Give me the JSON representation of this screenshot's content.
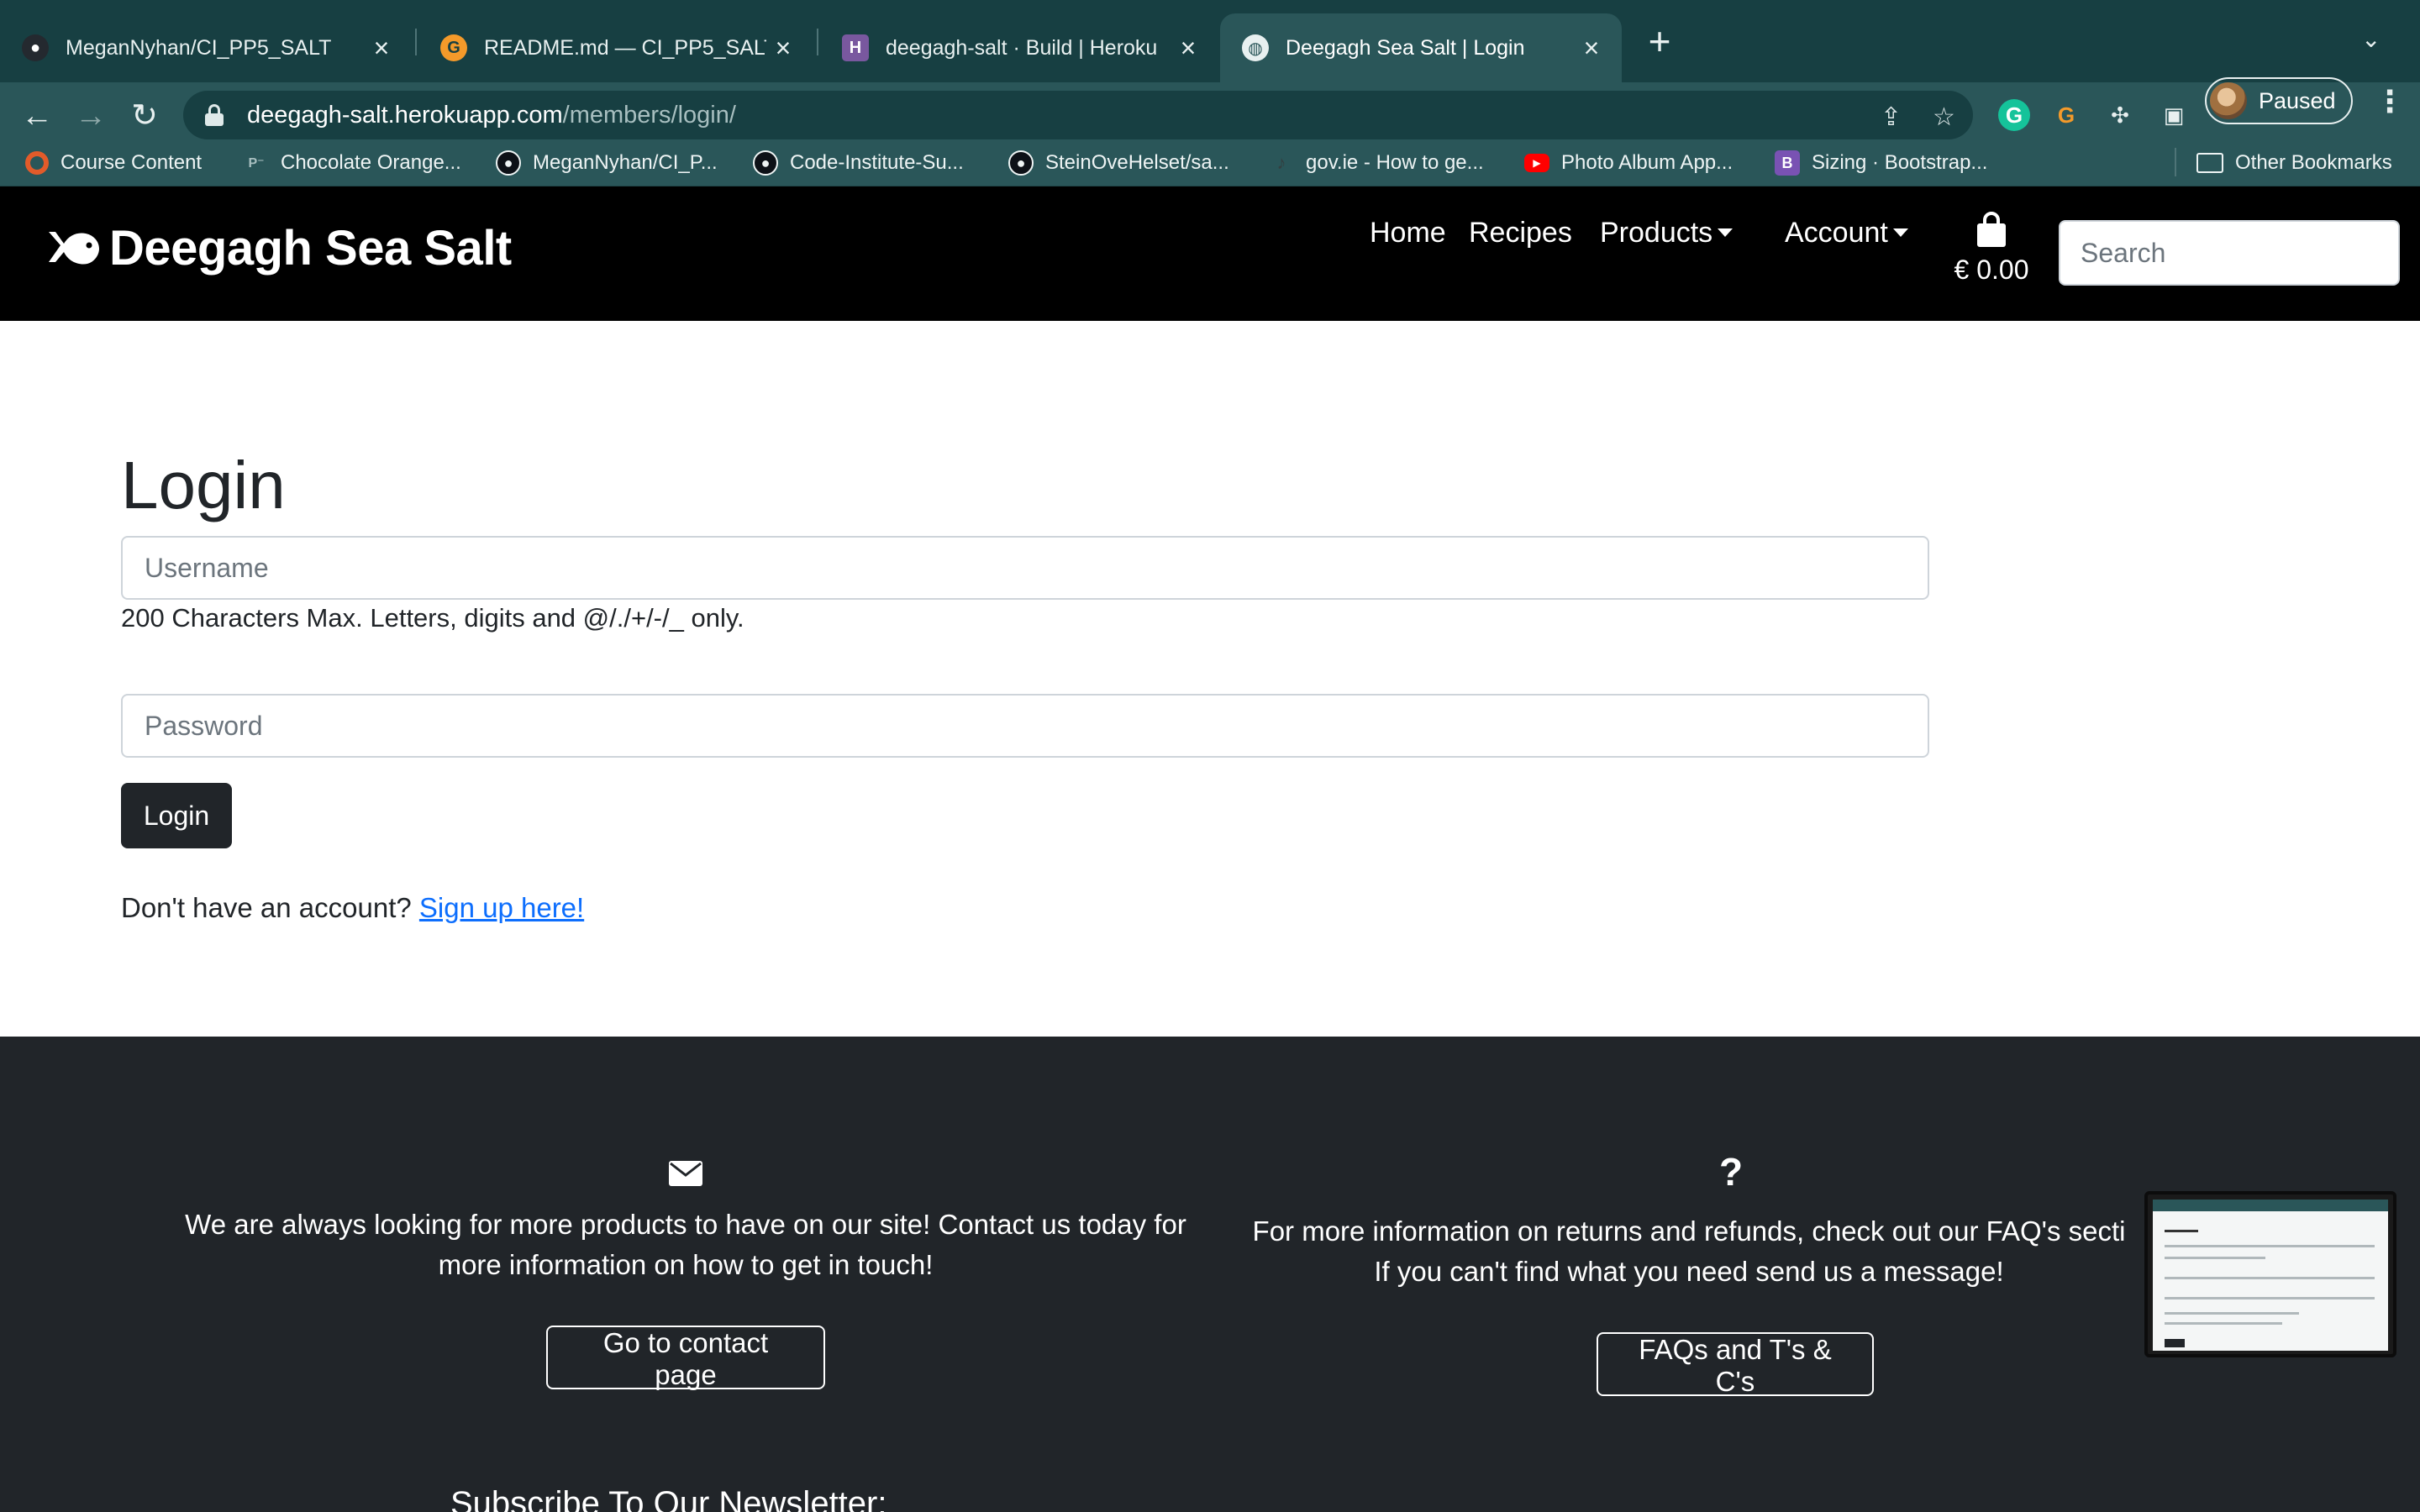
{
  "browser": {
    "tabs": [
      {
        "title": "MeganNyhan/CI_PP5_SALT",
        "favicon": "github-icon",
        "active": false
      },
      {
        "title": "README.md — CI_PP5_SALT —",
        "favicon": "gitpod-icon",
        "active": false
      },
      {
        "title": "deegagh-salt · Build | Heroku",
        "favicon": "heroku-icon",
        "active": false
      },
      {
        "title": "Deegagh Sea Salt | Login",
        "favicon": "globe-icon",
        "active": true
      }
    ],
    "url_host": "deegagh-salt.herokuapp.com",
    "url_path": "/members/login/",
    "profile_label": "Paused",
    "bookmarks": [
      {
        "label": "Course Content",
        "icon": "circle-icon"
      },
      {
        "label": "Chocolate Orange...",
        "icon": "p-icon"
      },
      {
        "label": "MeganNyhan/CI_P...",
        "icon": "github-icon"
      },
      {
        "label": "Code-Institute-Su...",
        "icon": "github-icon"
      },
      {
        "label": "SteinOveHelset/sa...",
        "icon": "github-icon"
      },
      {
        "label": "gov.ie - How to ge...",
        "icon": "harp-icon"
      },
      {
        "label": "Photo Album App...",
        "icon": "youtube-icon"
      },
      {
        "label": "Sizing · Bootstrap...",
        "icon": "bootstrap-icon"
      }
    ],
    "other_bookmarks": "Other Bookmarks"
  },
  "site": {
    "brand": "Deegagh Sea Salt",
    "nav": {
      "home": "Home",
      "recipes": "Recipes",
      "products": "Products",
      "account": "Account"
    },
    "bag_total": "€ 0.00",
    "search_placeholder": "Search"
  },
  "login": {
    "title": "Login",
    "username_placeholder": "Username",
    "username_help": "200 Characters Max. Letters, digits and @/./+/-/_ only.",
    "password_placeholder": "Password",
    "button": "Login",
    "signup_prompt": "Don't have an account?",
    "signup_link": "Sign up here!"
  },
  "footer": {
    "contact_line1": "We are always looking for more products to have on our site! Contact us today for",
    "contact_line2": "more information on how to get in touch!",
    "contact_button": "Go to contact page",
    "faq_icon_char": "?",
    "faq_line1": "For more information on returns and refunds, check out our FAQ's secti",
    "faq_line2": "If you can't find what you need send us a message!",
    "faq_button": "FAQs and T's & C's",
    "newsletter": "Subscribe To Our Newsletter:"
  },
  "colors": {
    "chrome_dark": "#173f42",
    "chrome": "#2a5659",
    "header": "#000000",
    "footer": "#212529",
    "link": "#0d6efd"
  }
}
